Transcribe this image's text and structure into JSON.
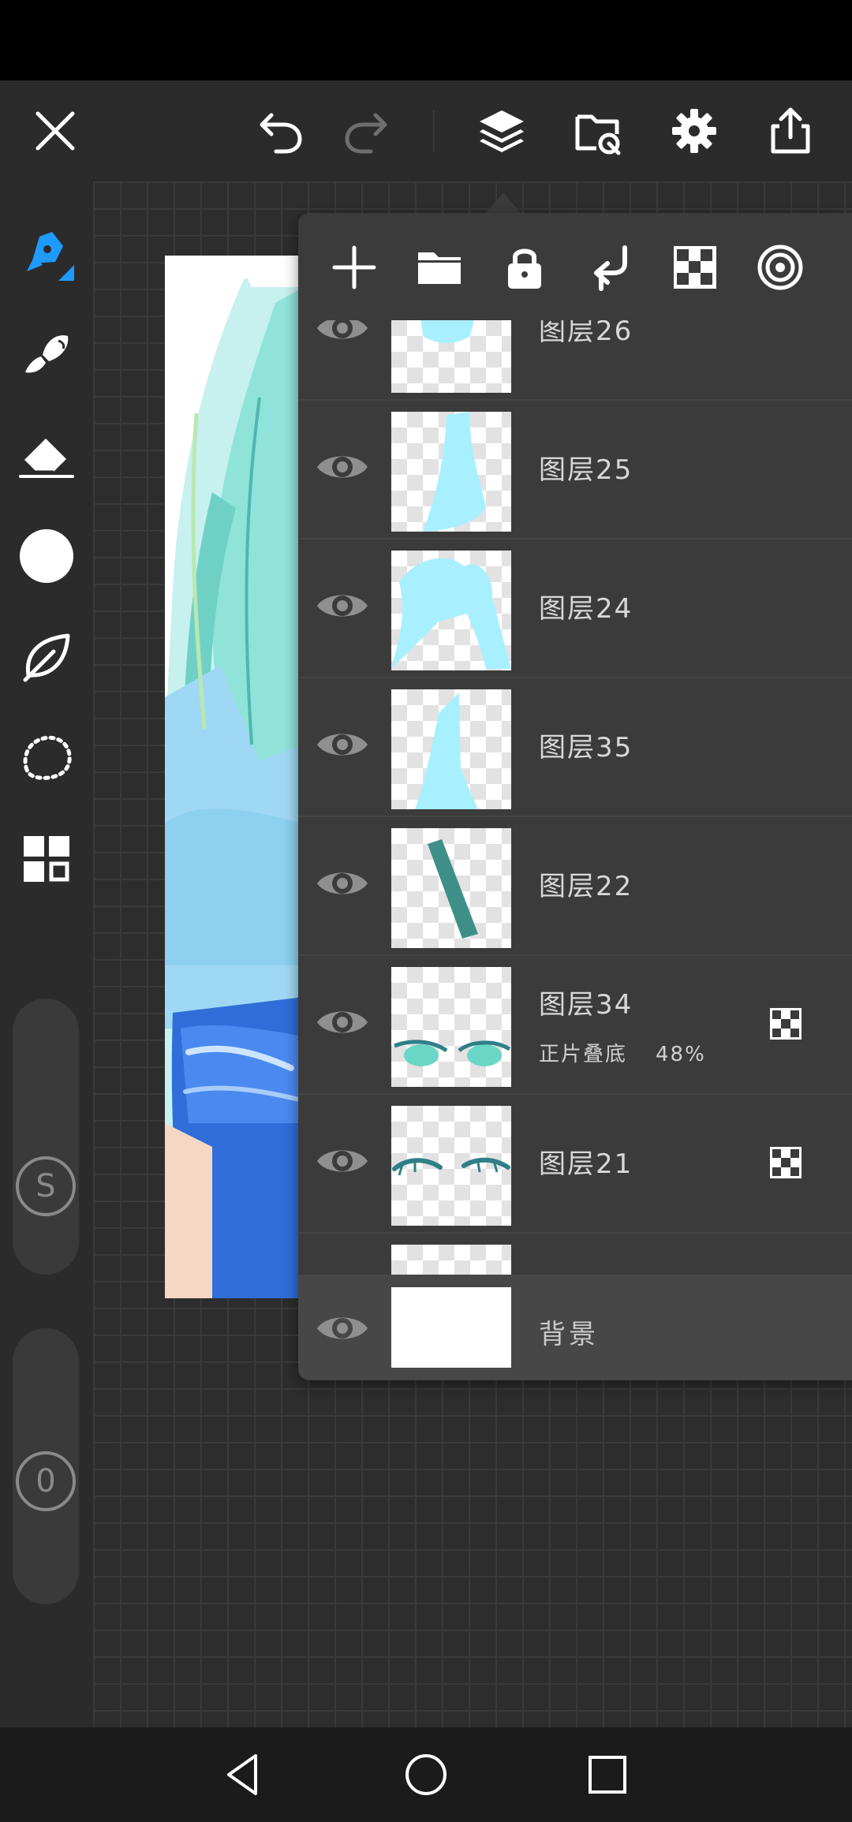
{
  "app": {
    "status_bar": {},
    "toolbar": {
      "icons": [
        "close-icon",
        "undo-icon",
        "redo-icon",
        "layers-icon",
        "import-file-icon",
        "settings-icon",
        "share-icon"
      ]
    },
    "tools": {
      "icons": [
        "pen-icon",
        "smudge-brush-icon",
        "eraser-icon",
        "color-circle-icon",
        "leaf-brush-icon",
        "lasso-selection-icon",
        "grid-menu-icon"
      ],
      "brush_size_label": "S",
      "opacity_label": "0",
      "current_color": "#ffffff",
      "active_color": "#1e9bff"
    }
  },
  "layer_panel": {
    "actions": [
      "add-layer-icon",
      "folder-icon",
      "lock-icon",
      "merge-down-icon",
      "alpha-lock-icon",
      "layer-effects-icon"
    ],
    "layers": [
      {
        "name": "图层26",
        "visible": true
      },
      {
        "name": "图层25",
        "visible": true
      },
      {
        "name": "图层24",
        "visible": true
      },
      {
        "name": "图层35",
        "visible": true
      },
      {
        "name": "图层22",
        "visible": true
      },
      {
        "name": "图层34",
        "blend_mode": "正片叠底",
        "opacity": "48%",
        "visible": true,
        "clipping": true
      },
      {
        "name": "图层21",
        "visible": true,
        "clipping": true
      }
    ],
    "background_layer": {
      "name": "背景",
      "visible": true
    }
  },
  "nav": {
    "icons": [
      "back-icon",
      "home-icon",
      "recents-icon"
    ]
  }
}
